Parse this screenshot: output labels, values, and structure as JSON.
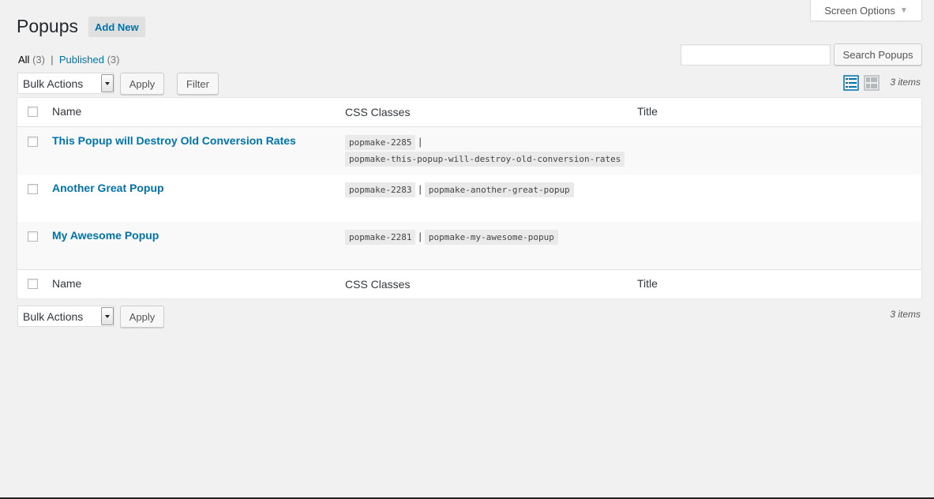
{
  "header": {
    "screen_options": "Screen Options",
    "title": "Popups",
    "add_new": "Add New"
  },
  "filters": {
    "all_label": "All",
    "all_count": "(3)",
    "separator": "|",
    "published_label": "Published",
    "published_count": "(3)"
  },
  "search": {
    "value": "",
    "button": "Search Popups"
  },
  "toolbar_top": {
    "bulk_actions": "Bulk Actions",
    "apply": "Apply",
    "filter": "Filter",
    "items_count": "3 items"
  },
  "table": {
    "columns": [
      "Name",
      "CSS Classes",
      "Title"
    ],
    "rows": [
      {
        "name": "This Popup will Destroy Old Conversion Rates",
        "class_id": "popmake-2285",
        "class_slug": "popmake-this-popup-will-destroy-old-conversion-rates",
        "title": ""
      },
      {
        "name": "Another Great Popup",
        "class_id": "popmake-2283",
        "class_slug": "popmake-another-great-popup",
        "title": ""
      },
      {
        "name": "My Awesome Popup",
        "class_id": "popmake-2281",
        "class_slug": "popmake-my-awesome-popup",
        "title": ""
      }
    ]
  },
  "toolbar_bottom": {
    "bulk_actions": "Bulk Actions",
    "apply": "Apply",
    "items_count": "3 items"
  },
  "colors": {
    "link": "#0073aa",
    "background": "#f1f1f1"
  },
  "icons": {
    "list_view": "list-view-icon",
    "excerpt_view": "excerpt-view-icon"
  }
}
